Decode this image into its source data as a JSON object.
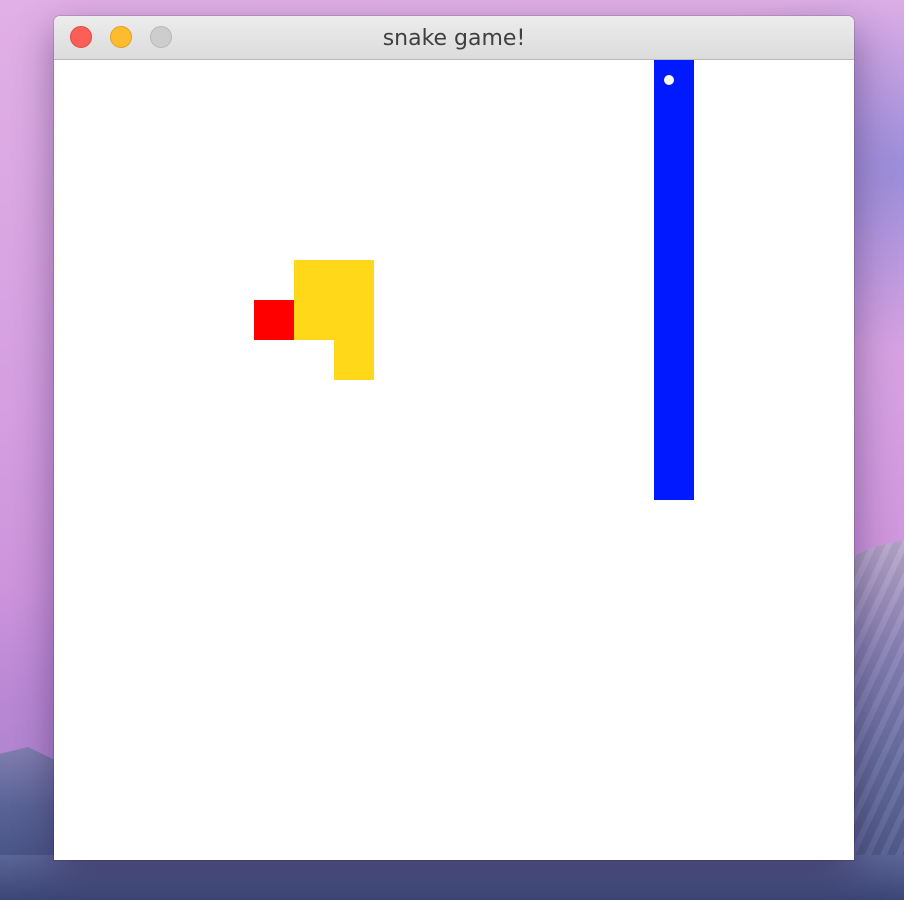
{
  "window": {
    "title": "snake game!"
  },
  "colors": {
    "board_background": "#ffffff",
    "food": "#ff0000",
    "yellow_snake": "#ffd819",
    "blue_snake": "#0019ff",
    "eye": "#ffffff"
  },
  "board": {
    "grid_columns": 20,
    "grid_rows": 20
  },
  "food": {
    "col": 5,
    "row": 6
  },
  "yellow_snake": {
    "segments": [
      [
        6,
        5
      ],
      [
        7,
        5
      ],
      [
        7,
        6
      ],
      [
        6,
        6
      ],
      [
        7,
        7
      ]
    ]
  },
  "blue_snake": {
    "head": [
      15,
      0
    ],
    "segments": [
      [
        15,
        0
      ],
      [
        15,
        1
      ],
      [
        15,
        2
      ],
      [
        15,
        3
      ],
      [
        15,
        4
      ],
      [
        15,
        5
      ],
      [
        15,
        6
      ],
      [
        15,
        7
      ],
      [
        15,
        8
      ],
      [
        15,
        9
      ],
      [
        15,
        10
      ]
    ]
  },
  "icons": {
    "close": "close-button-icon",
    "minimize": "minimize-button-icon",
    "zoom": "zoom-button-icon"
  }
}
